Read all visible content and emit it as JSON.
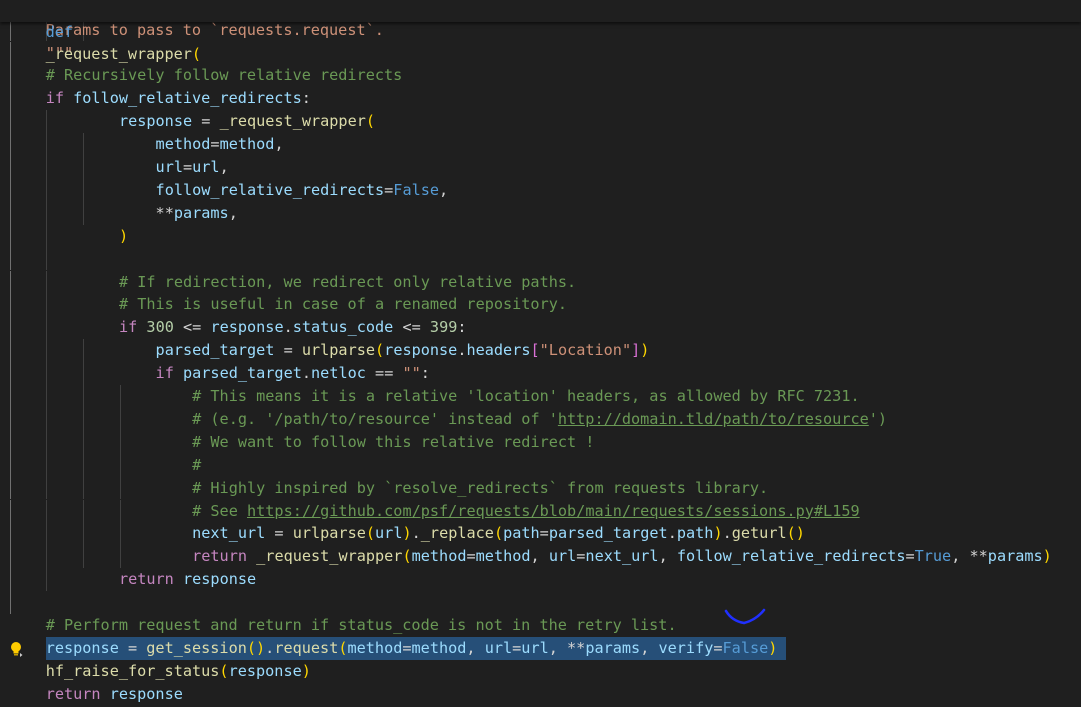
{
  "sticky_header": {
    "keyword": "def",
    "function_name": "_request_wrapper",
    "open_paren": "("
  },
  "lines": [
    [
      {
        "t": "    ",
        "c": "op"
      },
      {
        "t": "Params to pass to `requests.request`.",
        "c": "str"
      }
    ],
    [
      {
        "t": "\"\"\"",
        "c": "str"
      }
    ],
    [
      {
        "t": "# Recursively follow relative redirects",
        "c": "cm"
      }
    ],
    [
      {
        "t": "if",
        "c": "ctl"
      },
      {
        "t": " ",
        "c": "op"
      },
      {
        "t": "follow_relative_redirects",
        "c": "var"
      },
      {
        "t": ":",
        "c": "op"
      }
    ],
    [
      {
        "t": "    ",
        "c": "op"
      },
      {
        "t": "response",
        "c": "var"
      },
      {
        "t": " = ",
        "c": "op"
      },
      {
        "t": "_request_wrapper",
        "c": "fn"
      },
      {
        "t": "(",
        "c": "br1"
      }
    ],
    [
      {
        "t": "        ",
        "c": "op"
      },
      {
        "t": "method",
        "c": "var"
      },
      {
        "t": "=",
        "c": "op"
      },
      {
        "t": "method",
        "c": "var"
      },
      {
        "t": ",",
        "c": "op"
      }
    ],
    [
      {
        "t": "        ",
        "c": "op"
      },
      {
        "t": "url",
        "c": "var"
      },
      {
        "t": "=",
        "c": "op"
      },
      {
        "t": "url",
        "c": "var"
      },
      {
        "t": ",",
        "c": "op"
      }
    ],
    [
      {
        "t": "        ",
        "c": "op"
      },
      {
        "t": "follow_relative_redirects",
        "c": "var"
      },
      {
        "t": "=",
        "c": "op"
      },
      {
        "t": "False",
        "c": "kw"
      },
      {
        "t": ",",
        "c": "op"
      }
    ],
    [
      {
        "t": "        ",
        "c": "op"
      },
      {
        "t": "**",
        "c": "op"
      },
      {
        "t": "params",
        "c": "var"
      },
      {
        "t": ",",
        "c": "op"
      }
    ],
    [
      {
        "t": "    ",
        "c": "op"
      },
      {
        "t": ")",
        "c": "br1"
      }
    ],
    [],
    [
      {
        "t": "    ",
        "c": "op"
      },
      {
        "t": "# If redirection, we redirect only relative paths.",
        "c": "cm"
      }
    ],
    [
      {
        "t": "    ",
        "c": "op"
      },
      {
        "t": "# This is useful in case of a renamed repository.",
        "c": "cm"
      }
    ],
    [
      {
        "t": "    ",
        "c": "op"
      },
      {
        "t": "if",
        "c": "ctl"
      },
      {
        "t": " ",
        "c": "op"
      },
      {
        "t": "300",
        "c": "num"
      },
      {
        "t": " <= ",
        "c": "op"
      },
      {
        "t": "response",
        "c": "var"
      },
      {
        "t": ".",
        "c": "op"
      },
      {
        "t": "status_code",
        "c": "var"
      },
      {
        "t": " <= ",
        "c": "op"
      },
      {
        "t": "399",
        "c": "num"
      },
      {
        "t": ":",
        "c": "op"
      }
    ],
    [
      {
        "t": "        ",
        "c": "op"
      },
      {
        "t": "parsed_target",
        "c": "var"
      },
      {
        "t": " = ",
        "c": "op"
      },
      {
        "t": "urlparse",
        "c": "fn"
      },
      {
        "t": "(",
        "c": "br1"
      },
      {
        "t": "response",
        "c": "var"
      },
      {
        "t": ".",
        "c": "op"
      },
      {
        "t": "headers",
        "c": "var"
      },
      {
        "t": "[",
        "c": "br2"
      },
      {
        "t": "\"Location\"",
        "c": "str"
      },
      {
        "t": "]",
        "c": "br2"
      },
      {
        "t": ")",
        "c": "br1"
      }
    ],
    [
      {
        "t": "        ",
        "c": "op"
      },
      {
        "t": "if",
        "c": "ctl"
      },
      {
        "t": " ",
        "c": "op"
      },
      {
        "t": "parsed_target",
        "c": "var"
      },
      {
        "t": ".",
        "c": "op"
      },
      {
        "t": "netloc",
        "c": "var"
      },
      {
        "t": " == ",
        "c": "op"
      },
      {
        "t": "\"\"",
        "c": "str"
      },
      {
        "t": ":",
        "c": "op"
      }
    ],
    [
      {
        "t": "            ",
        "c": "op"
      },
      {
        "t": "# This means it is a relative 'location' headers, as allowed by RFC 7231.",
        "c": "cm"
      }
    ],
    [
      {
        "t": "            ",
        "c": "op"
      },
      {
        "t": "# (e.g. '/path/to/resource' instead of '",
        "c": "cm"
      },
      {
        "t": "http://domain.tld/path/to/resource",
        "c": "cm lnk"
      },
      {
        "t": "')",
        "c": "cm"
      }
    ],
    [
      {
        "t": "            ",
        "c": "op"
      },
      {
        "t": "# We want to follow this relative redirect !",
        "c": "cm"
      }
    ],
    [
      {
        "t": "            ",
        "c": "op"
      },
      {
        "t": "#",
        "c": "cm"
      }
    ],
    [
      {
        "t": "            ",
        "c": "op"
      },
      {
        "t": "# Highly inspired by `resolve_redirects` from requests library.",
        "c": "cm"
      }
    ],
    [
      {
        "t": "            ",
        "c": "op"
      },
      {
        "t": "# See ",
        "c": "cm"
      },
      {
        "t": "https://github.com/psf/requests/blob/main/requests/sessions.py#L159",
        "c": "cm lnk"
      }
    ],
    [
      {
        "t": "            ",
        "c": "op"
      },
      {
        "t": "next_url",
        "c": "var"
      },
      {
        "t": " = ",
        "c": "op"
      },
      {
        "t": "urlparse",
        "c": "fn"
      },
      {
        "t": "(",
        "c": "br1"
      },
      {
        "t": "url",
        "c": "var"
      },
      {
        "t": ")",
        "c": "br1"
      },
      {
        "t": ".",
        "c": "op"
      },
      {
        "t": "_replace",
        "c": "fn"
      },
      {
        "t": "(",
        "c": "br1"
      },
      {
        "t": "path",
        "c": "var"
      },
      {
        "t": "=",
        "c": "op"
      },
      {
        "t": "parsed_target",
        "c": "var"
      },
      {
        "t": ".",
        "c": "op"
      },
      {
        "t": "path",
        "c": "var"
      },
      {
        "t": ")",
        "c": "br1"
      },
      {
        "t": ".",
        "c": "op"
      },
      {
        "t": "geturl",
        "c": "fn"
      },
      {
        "t": "()",
        "c": "br1"
      }
    ],
    [
      {
        "t": "            ",
        "c": "op"
      },
      {
        "t": "return",
        "c": "ctl"
      },
      {
        "t": " ",
        "c": "op"
      },
      {
        "t": "_request_wrapper",
        "c": "fn"
      },
      {
        "t": "(",
        "c": "br1"
      },
      {
        "t": "method",
        "c": "var"
      },
      {
        "t": "=",
        "c": "op"
      },
      {
        "t": "method",
        "c": "var"
      },
      {
        "t": ", ",
        "c": "op"
      },
      {
        "t": "url",
        "c": "var"
      },
      {
        "t": "=",
        "c": "op"
      },
      {
        "t": "next_url",
        "c": "var"
      },
      {
        "t": ", ",
        "c": "op"
      },
      {
        "t": "follow_relative_redirects",
        "c": "var"
      },
      {
        "t": "=",
        "c": "op"
      },
      {
        "t": "True",
        "c": "kw"
      },
      {
        "t": ", ",
        "c": "op"
      },
      {
        "t": "**",
        "c": "op"
      },
      {
        "t": "params",
        "c": "var"
      },
      {
        "t": ")",
        "c": "br1"
      }
    ],
    [
      {
        "t": "    ",
        "c": "op"
      },
      {
        "t": "return",
        "c": "ctl"
      },
      {
        "t": " ",
        "c": "op"
      },
      {
        "t": "response",
        "c": "var"
      }
    ],
    [],
    [
      {
        "t": "# Perform request and return if status_code is not in the retry list.",
        "c": "cm"
      }
    ],
    [
      {
        "t": "response",
        "c": "var"
      },
      {
        "t": " = ",
        "c": "op"
      },
      {
        "t": "get_session",
        "c": "fn"
      },
      {
        "t": "()",
        "c": "br1"
      },
      {
        "t": ".",
        "c": "op"
      },
      {
        "t": "request",
        "c": "fn"
      },
      {
        "t": "(",
        "c": "br1"
      },
      {
        "t": "method",
        "c": "var"
      },
      {
        "t": "=",
        "c": "op"
      },
      {
        "t": "method",
        "c": "var"
      },
      {
        "t": ", ",
        "c": "op"
      },
      {
        "t": "url",
        "c": "var"
      },
      {
        "t": "=",
        "c": "op"
      },
      {
        "t": "url",
        "c": "var"
      },
      {
        "t": ", ",
        "c": "op"
      },
      {
        "t": "**",
        "c": "op"
      },
      {
        "t": "params",
        "c": "var"
      },
      {
        "t": ", ",
        "c": "op"
      },
      {
        "t": "verify",
        "c": "var"
      },
      {
        "t": "=",
        "c": "op"
      },
      {
        "t": "False",
        "c": "kw"
      },
      {
        "t": ")",
        "c": "br1"
      }
    ],
    [
      {
        "t": "hf_raise_for_status",
        "c": "fn"
      },
      {
        "t": "(",
        "c": "br1"
      },
      {
        "t": "response",
        "c": "var"
      },
      {
        "t": ")",
        "c": "br1"
      }
    ],
    [
      {
        "t": "return",
        "c": "ctl"
      },
      {
        "t": " ",
        "c": "op"
      },
      {
        "t": "response",
        "c": "var"
      }
    ]
  ],
  "line_meta": [
    {
      "indent": 3
    },
    {
      "indent": 1
    },
    {
      "indent": 1
    },
    {
      "indent": 1
    },
    {
      "indent": 2
    },
    {
      "indent": 3
    },
    {
      "indent": 3
    },
    {
      "indent": 3
    },
    {
      "indent": 3
    },
    {
      "indent": 2
    },
    {
      "indent": 2
    },
    {
      "indent": 2
    },
    {
      "indent": 2
    },
    {
      "indent": 2
    },
    {
      "indent": 3
    },
    {
      "indent": 3
    },
    {
      "indent": 4
    },
    {
      "indent": 4
    },
    {
      "indent": 4
    },
    {
      "indent": 4
    },
    {
      "indent": 4
    },
    {
      "indent": 4
    },
    {
      "indent": 4
    },
    {
      "indent": 4
    },
    {
      "indent": 2
    },
    {
      "indent": 1
    },
    {
      "indent": 1
    },
    {
      "indent": 1,
      "selected": true,
      "lightbulb": true
    },
    {
      "indent": 1
    },
    {
      "indent": 1
    }
  ],
  "colors": {
    "background": "#1f1f1f",
    "keyword": "#569cd6",
    "control": "#c586c0",
    "function": "#dcdcaa",
    "variable": "#9cdcfe",
    "string": "#ce9178",
    "number": "#b5cea8",
    "comment": "#6a9955",
    "selection": "#264f78",
    "annotation_ink": "#2030ff"
  },
  "icons": {
    "lightbulb": "lightbulb-icon",
    "annotation": "checkmark-annotation"
  }
}
